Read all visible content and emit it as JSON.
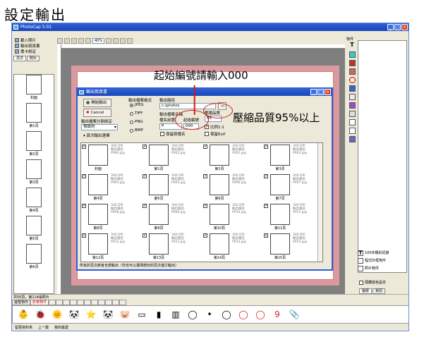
{
  "heading": "設定輸出",
  "app": {
    "title": "PhotoCap 5.01",
    "menu": [
      "",
      "",
      "",
      "",
      "",
      "",
      "",
      ""
    ],
    "toolbar": {
      "zoom": "40%"
    },
    "left": {
      "actions": [
        "載入照片",
        "輸出寫真書",
        "專卡設定"
      ],
      "tabs": [
        "頁次",
        "照片"
      ],
      "pages": [
        "封面",
        "第1頁",
        "第2頁",
        "第3頁",
        "第4頁",
        "第5頁",
        "第6頁"
      ],
      "status": "共50頁，第114張照片"
    },
    "right": {
      "label": "物件",
      "layers": [
        "100年種彩紀錄",
        "程式外框物件",
        "照片物件"
      ],
      "check": "隱藏底色設定",
      "tabs": [
        "圖層",
        "資訊"
      ]
    },
    "bottom_tabs": [
      "邊框物件",
      "影像物件",
      "",
      "",
      "",
      "",
      "",
      "",
      "",
      "",
      "",
      "",
      ""
    ],
    "bottom_bar": [
      "留更資料夾",
      "上一層",
      "我的最愛"
    ]
  },
  "dialog": {
    "title": "輸出寫真書",
    "output_button": "開始輸出",
    "cancel_button": "Cancel",
    "naming_label": "輸出檔案分割設定",
    "naming_value": "預設的",
    "page_options": "頁次輸出選擇",
    "format_label": "輸出檔案格式",
    "formats": [
      "JPEG",
      "TIFF",
      "PNG",
      "BMP"
    ],
    "path_label": "輸出路徑",
    "path_value": "c:\\photos",
    "name_label": "輸出檔案名稱",
    "prefix_label": "檔名前置",
    "start_label": "起始編號",
    "start_value": "000",
    "prefix_value": "P",
    "keep_name": "保留原檔名",
    "quality_label": "壓縮品質",
    "quality_value": "95",
    "ratio_label": "比例1:1",
    "keep_exif": "保留Exif",
    "cells": [
      {
        "label": "封面",
        "dpi": "300 DPI",
        "name": "輸出檔名",
        "file": "P000.jpg"
      },
      {
        "label": "第1頁",
        "dpi": "300 DPI",
        "name": "輸出檔名",
        "file": "P001.jpg"
      },
      {
        "label": "第2頁",
        "dpi": "300 DPI",
        "name": "輸出檔名",
        "file": "P002.jpg"
      },
      {
        "label": "第3頁",
        "dpi": "300 DPI",
        "name": "輸出檔名",
        "file": "P003.jpg"
      },
      {
        "label": "第4頁",
        "dpi": "300 DPI",
        "name": "輸出檔名",
        "file": "P004.jpg"
      },
      {
        "label": "第5頁",
        "dpi": "300 DPI",
        "name": "輸出檔名",
        "file": "P005.jpg"
      },
      {
        "label": "第6頁",
        "dpi": "300 DPI",
        "name": "輸出檔名",
        "file": "P006.jpg"
      },
      {
        "label": "第7頁",
        "dpi": "300 DPI",
        "name": "輸出檔名",
        "file": "P007.jpg"
      },
      {
        "label": "第8頁",
        "dpi": "300 DPI",
        "name": "輸出檔名",
        "file": "P008.jpg"
      },
      {
        "label": "第9頁",
        "dpi": "300 DPI",
        "name": "輸出檔名",
        "file": "P009.jpg"
      },
      {
        "label": "第10頁",
        "dpi": "300 DPI",
        "name": "輸出檔名",
        "file": "P010.jpg"
      },
      {
        "label": "第11頁",
        "dpi": "300 DPI",
        "name": "輸出檔名",
        "file": "P011.jpg"
      },
      {
        "label": "第12頁",
        "dpi": "300 DPI",
        "name": "輸出檔名",
        "file": "P012.jpg"
      },
      {
        "label": "第13頁",
        "dpi": "300 DPI",
        "name": "輸出檔名",
        "file": "P013.jpg"
      },
      {
        "label": "第14頁",
        "dpi": "300 DPI",
        "name": "輸出檔名",
        "file": "P014.jpg"
      },
      {
        "label": "第15頁",
        "dpi": "300 DPI",
        "name": "輸出檔名",
        "file": "P015.jpg"
      }
    ],
    "status": "所有的頁次將會全部輸出（你也可以選擇部份的頁次進行輸出）"
  },
  "annotations": {
    "start_note": "起始編號請輸入000",
    "quality_note": "壓縮品質95%以上",
    "color": "#d81818"
  }
}
